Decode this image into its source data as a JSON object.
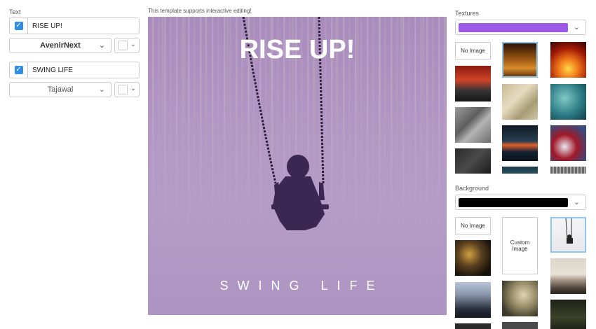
{
  "text_panel": {
    "label": "Text",
    "lines": [
      {
        "value": "RISE UP!",
        "font": "AvenirNext"
      },
      {
        "value": "SWING LIFE",
        "font": "Tajawal"
      }
    ]
  },
  "canvas": {
    "notice": "This template supports interactive editing!",
    "title": "RISE UP!",
    "subtitle": "SWING LIFE"
  },
  "textures": {
    "label": "Textures",
    "selected_color": "#9b59e6",
    "no_image_label": "No Image"
  },
  "background": {
    "label": "Background",
    "selected_color": "#000000",
    "no_image_label": "No Image",
    "custom_image_label": "Custom Image"
  },
  "colors": {
    "accent": "#2f8de4",
    "canvas_purple": "#b097c3",
    "selection_border": "#8fc6ee"
  }
}
